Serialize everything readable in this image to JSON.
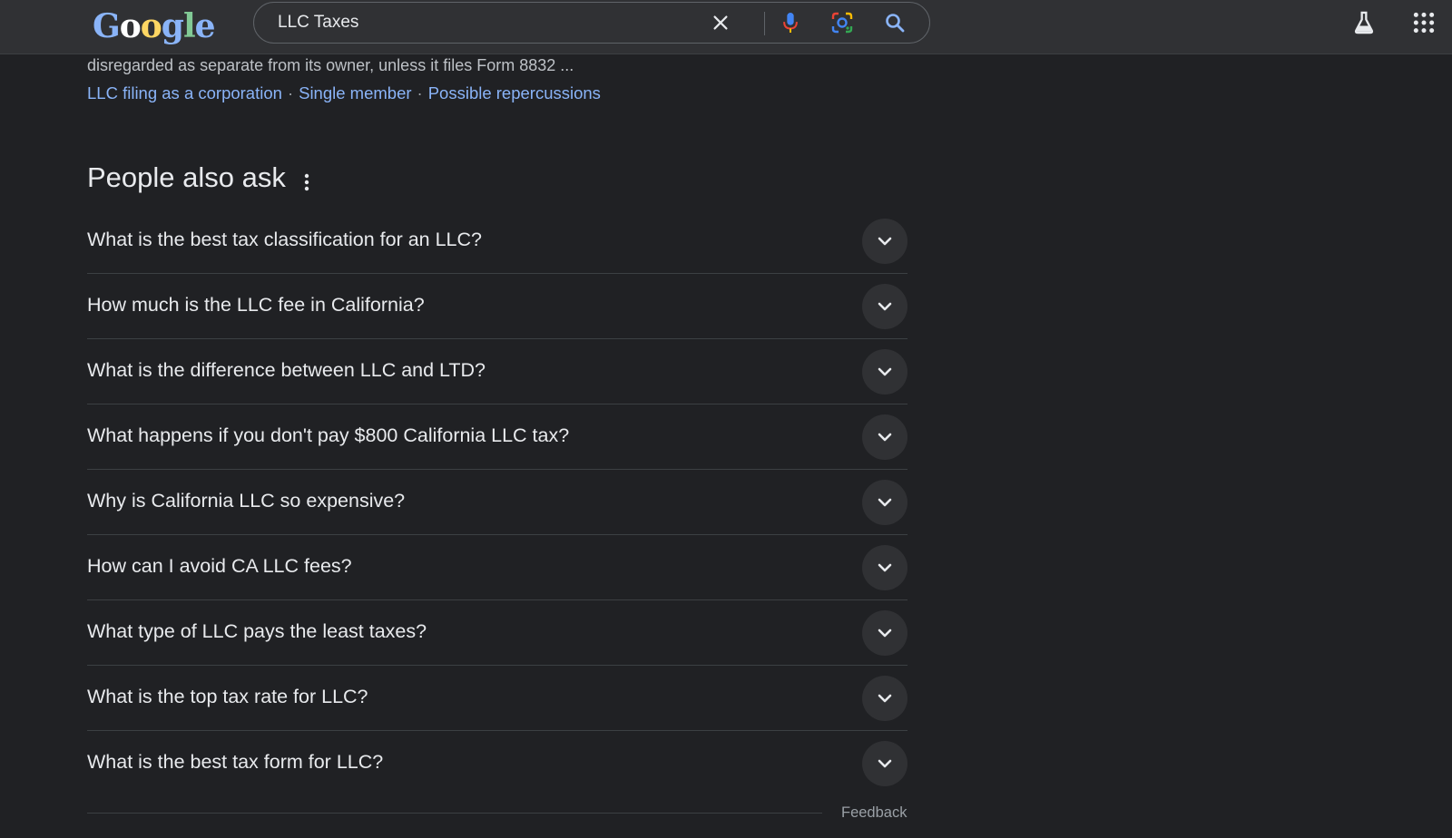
{
  "header": {
    "logo_letters": [
      "G",
      "o",
      "o",
      "g",
      "l",
      "e"
    ],
    "search": {
      "value": "LLC Taxes"
    },
    "icons": {
      "clear": "close-icon",
      "voice": "microphone-icon",
      "lens": "camera-lens-icon",
      "search": "search-icon",
      "labs": "flask-icon",
      "apps": "apps-grid-icon"
    }
  },
  "result": {
    "snippet": "disregarded as separate from its owner, unless it files Form 8832 ...",
    "sitelinks": [
      "LLC filing as a corporation",
      "Single member",
      "Possible repercussions"
    ],
    "separator": "·"
  },
  "paa": {
    "title": "People also ask",
    "questions": [
      "What is the best tax classification for an LLC?",
      "How much is the LLC fee in California?",
      "What is the difference between LLC and LTD?",
      "What happens if you don't pay $800 California LLC tax?",
      "Why is California LLC so expensive?",
      "How can I avoid CA LLC fees?",
      "What type of LLC pays the least taxes?",
      "What is the top tax rate for LLC?",
      "What is the best tax form for LLC?"
    ],
    "feedback": "Feedback"
  },
  "colors": {
    "background": "#202124",
    "header": "#303134",
    "link": "#8ab4f8",
    "text": "#e8eaed",
    "muted": "#9aa0a6"
  }
}
